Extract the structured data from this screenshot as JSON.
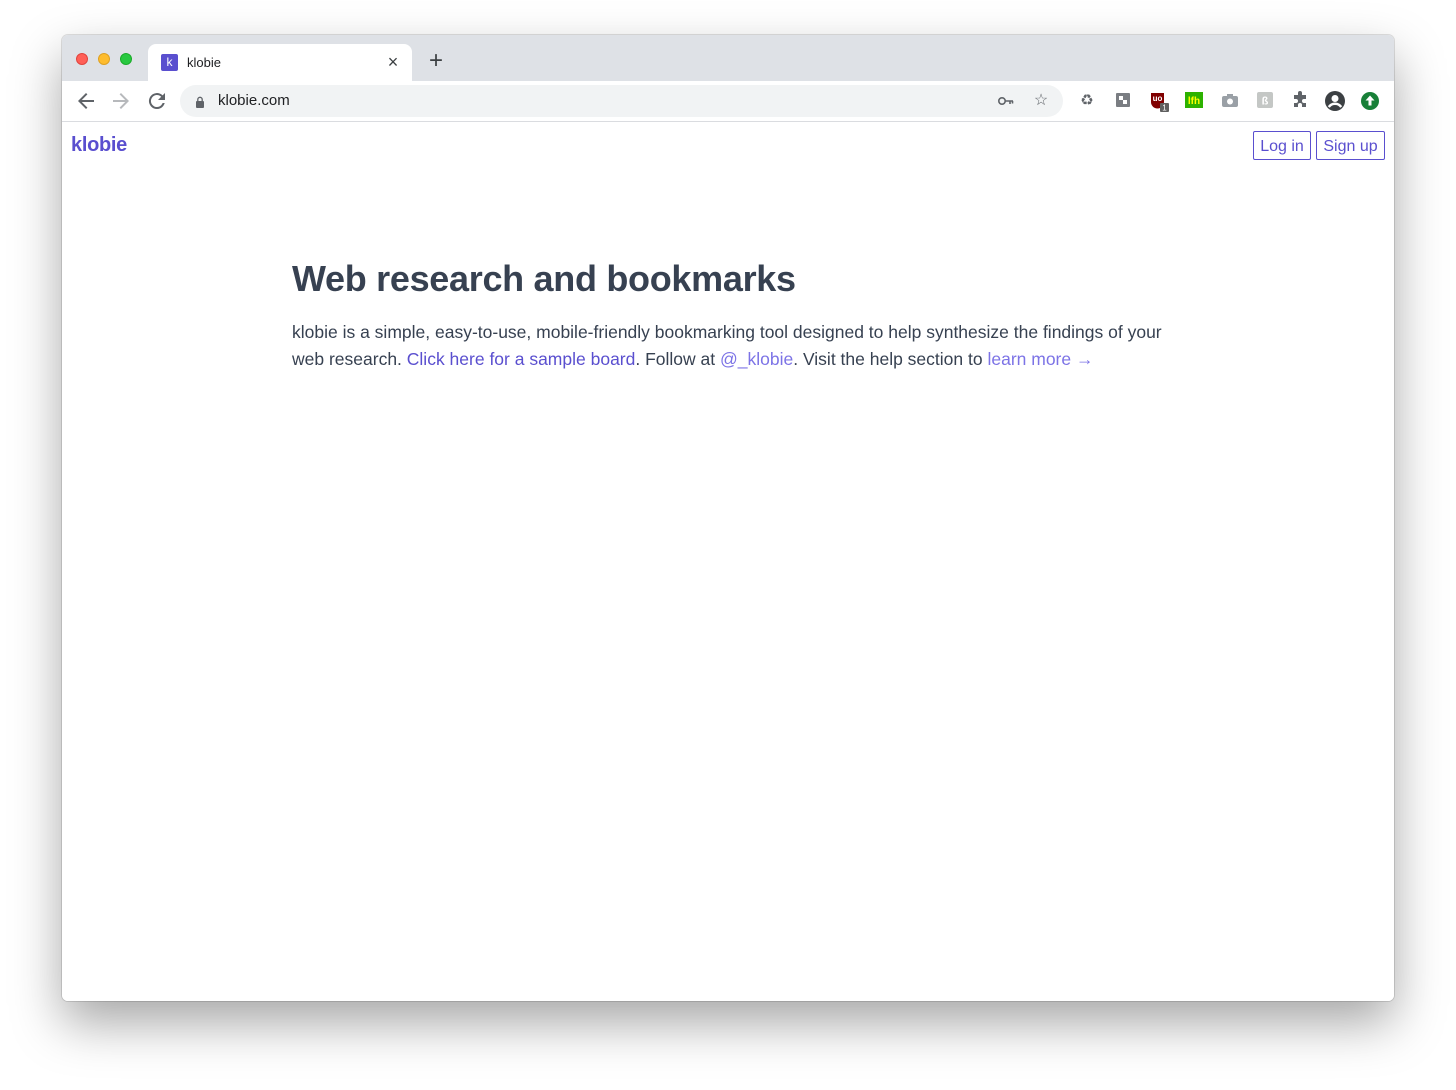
{
  "browser": {
    "tab": {
      "favicon_letter": "k",
      "title": "klobie"
    },
    "omnibox": {
      "url": "klobie.com"
    },
    "extensions": [
      {
        "name": "recycle-icon",
        "glyph": "♻"
      },
      {
        "name": "puzzle-ext-icon",
        "glyph": "▞"
      },
      {
        "name": "ublock-icon",
        "glyph": "u",
        "badge": "1"
      },
      {
        "name": "lfh-icon",
        "glyph": "lfh"
      },
      {
        "name": "camera-icon",
        "glyph": "◙"
      },
      {
        "name": "translate-icon",
        "glyph": "ℹ"
      },
      {
        "name": "extensions-icon",
        "glyph": "✚"
      },
      {
        "name": "profile-icon",
        "glyph": "●"
      },
      {
        "name": "update-icon",
        "glyph": "↑"
      }
    ]
  },
  "site": {
    "brand": "klobie",
    "nav": {
      "login_label": "Log in",
      "signup_label": "Sign up"
    },
    "hero": {
      "title": "Web research and bookmarks",
      "text_part1": "klobie is a simple, easy-to-use, mobile-friendly bookmarking tool designed to help synthesize the findings of your web research. ",
      "sample_link": "Click here for a sample board",
      "text_part2": ". Follow at ",
      "twitter_link": "@_klobie",
      "text_part3": ". Visit the help section to ",
      "learn_link": "learn more →"
    }
  },
  "colors": {
    "accent": "#5a4fcf",
    "text": "#374151",
    "tabstrip": "#dee1e6"
  }
}
